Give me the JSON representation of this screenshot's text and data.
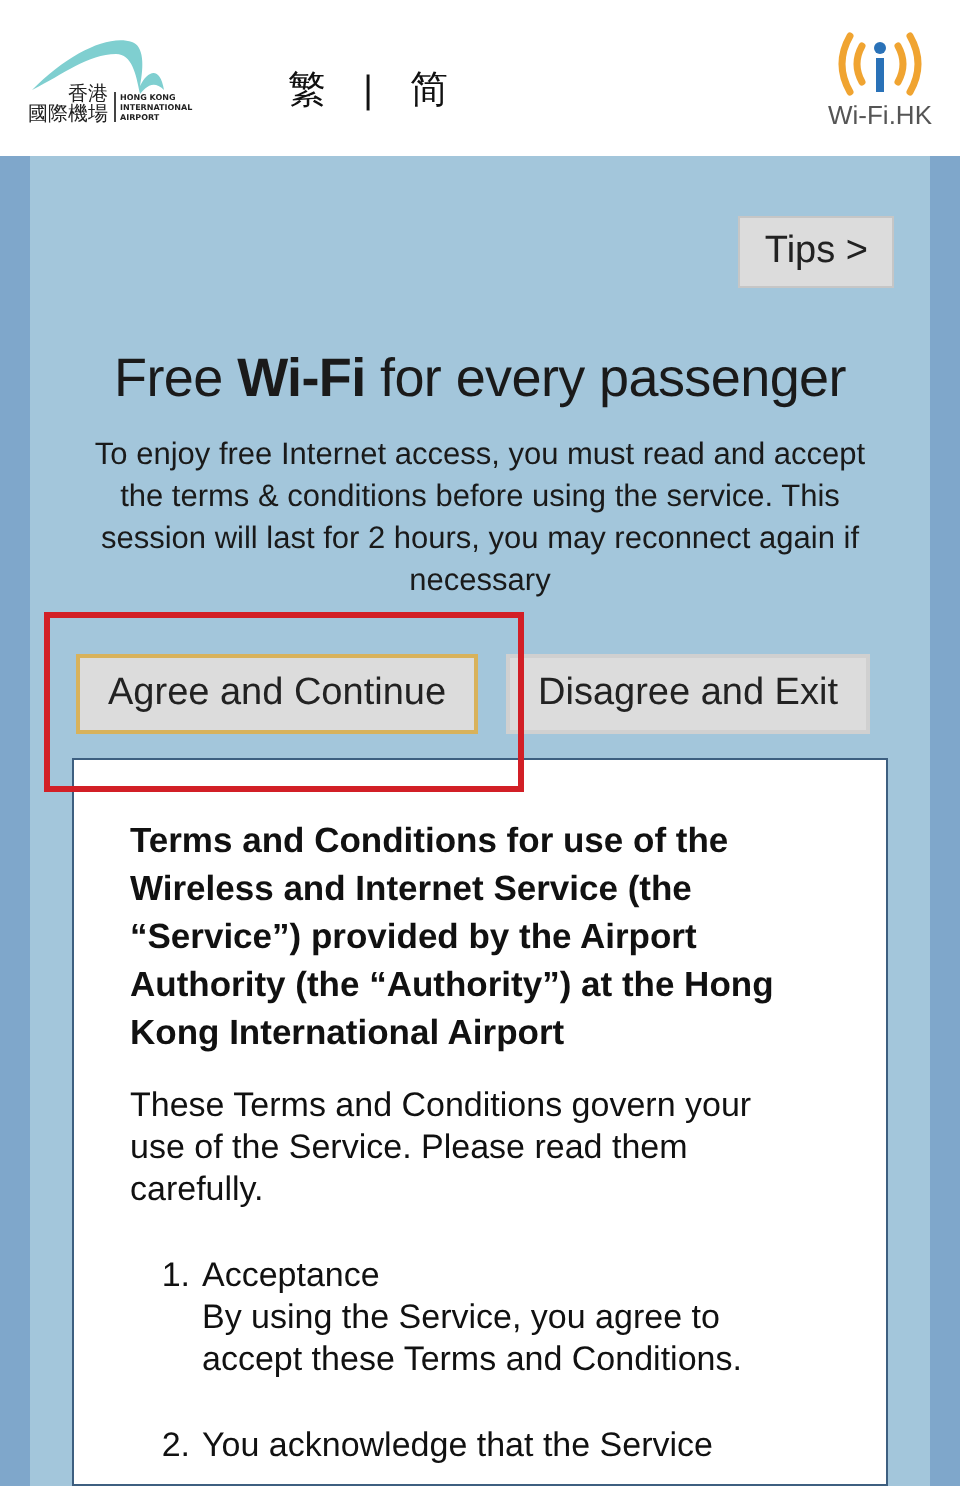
{
  "header": {
    "logo": {
      "chinese": [
        "香港",
        "國際機場"
      ],
      "english": [
        "HONG KONG",
        "INTERNATIONAL",
        "AIRPORT"
      ]
    },
    "languages": [
      {
        "label": "繁",
        "selected": false
      },
      {
        "label": "简",
        "selected": false
      }
    ],
    "separator": "|",
    "partner_logo": {
      "label": "Wi-Fi.HK"
    }
  },
  "tips_button": "Tips >",
  "headline": "Free **Wi-Fi** for every passenger",
  "intro": "To enjoy free Internet access, you must read and accept the terms & conditions before using the service. This session will last for 2 hours, you may reconnect again if necessary",
  "buttons": [
    {
      "label": "Agree and Continue",
      "selected": true
    },
    {
      "label": "Disagree and Exit",
      "selected": false
    }
  ],
  "annotation": {
    "kind": "highlight"
  },
  "terms": {
    "title": "Terms and Conditions for use of the Wireless and Internet Service (the “Service”) provided by the Airport Authority (the “Authority”) at the Hong Kong International Airport",
    "intro": "These Terms and Conditions govern your use of the Service. Please read them carefully.",
    "items": [
      {
        "number": "1.",
        "heading": "Acceptance",
        "text": "By using the Service, you agree to accept these Terms and Conditions."
      },
      {
        "number": "2.",
        "heading": "You acknowledge that the Service"
      }
    ]
  }
}
